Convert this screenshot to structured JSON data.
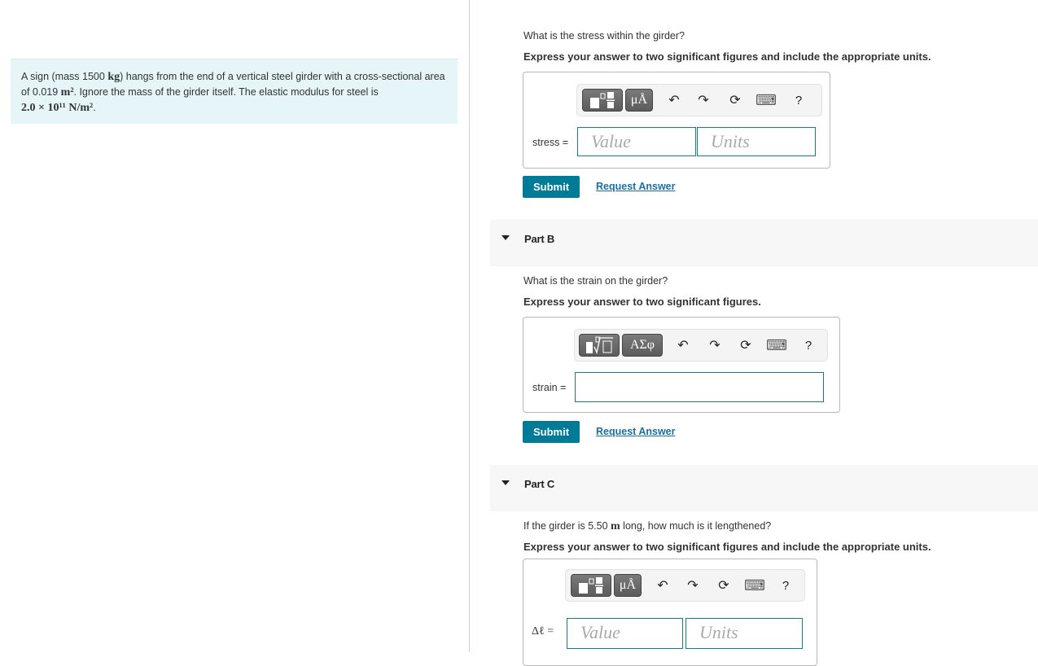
{
  "problem": {
    "text_1": "A sign (mass 1500 ",
    "unit_kg": "kg",
    "text_2": ") hangs from the end of a vertical steel girder with a cross-sectional area of 0.019 ",
    "unit_m2": "m²",
    "text_3": ". Ignore the mass of the girder itself. The elastic modulus for steel is ",
    "modulus": "2.0 × 10¹¹ N/m²",
    "text_4": "."
  },
  "part_a": {
    "question": "What is the stress within the girder?",
    "instruction": "Express your answer to two significant figures and include the appropriate units.",
    "toolbar": {
      "template_icon": "fraction-template-icon",
      "units_label": "μÅ",
      "undo": "↶",
      "redo": "↷",
      "reset": "⟳",
      "keyboard": "⌨",
      "help": "?"
    },
    "variable_label": "stress =",
    "value_placeholder": "Value",
    "units_placeholder": "Units",
    "submit_label": "Submit",
    "request_label": "Request Answer"
  },
  "part_b": {
    "header": "Part B",
    "question": "What is the strain on the girder?",
    "instruction": "Express your answer to two significant figures.",
    "toolbar": {
      "template_icon": "radical-template-icon",
      "symbols_label": "ΑΣφ",
      "undo": "↶",
      "redo": "↷",
      "reset": "⟳",
      "keyboard": "⌨",
      "help": "?"
    },
    "variable_label": "strain =",
    "value": "",
    "submit_label": "Submit",
    "request_label": "Request Answer"
  },
  "part_c": {
    "header": "Part C",
    "question_1": "If the girder is 5.50 ",
    "unit_m": "m",
    "question_2": " long, how much is it lengthened?",
    "instruction": "Express your answer to two significant figures and include the appropriate units.",
    "toolbar": {
      "template_icon": "fraction-template-icon",
      "units_label": "μÅ",
      "undo": "↶",
      "redo": "↷",
      "reset": "⟳",
      "keyboard": "⌨",
      "help": "?"
    },
    "variable_label": "Δℓ =",
    "value_placeholder": "Value",
    "units_placeholder": "Units"
  }
}
